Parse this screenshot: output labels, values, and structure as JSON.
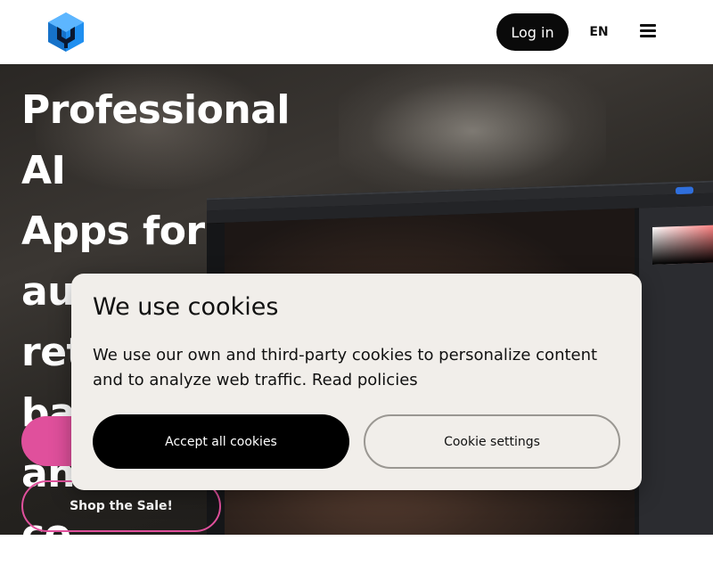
{
  "header": {
    "logo_icon": "brand-cube-logo",
    "login_label": "Log in",
    "language": "EN",
    "menu_icon": "hamburger-menu-icon",
    "brand_color": "#1f8ff0"
  },
  "hero": {
    "title_lines": [
      "Professional AI",
      "Apps for",
      "automated",
      "ret",
      "ba",
      "an",
      "co"
    ],
    "cta_primary_label": "",
    "cta_secondary_label": "Shop the Sale!",
    "accent_color": "#e0509c"
  },
  "cookie_banner": {
    "title": "We use cookies",
    "text": "We use our own and third-party cookies to personalize content and to analyze web traffic. Read policies",
    "accept_label": "Accept all cookies",
    "settings_label": "Cookie settings",
    "background_color": "#f1eeea"
  }
}
